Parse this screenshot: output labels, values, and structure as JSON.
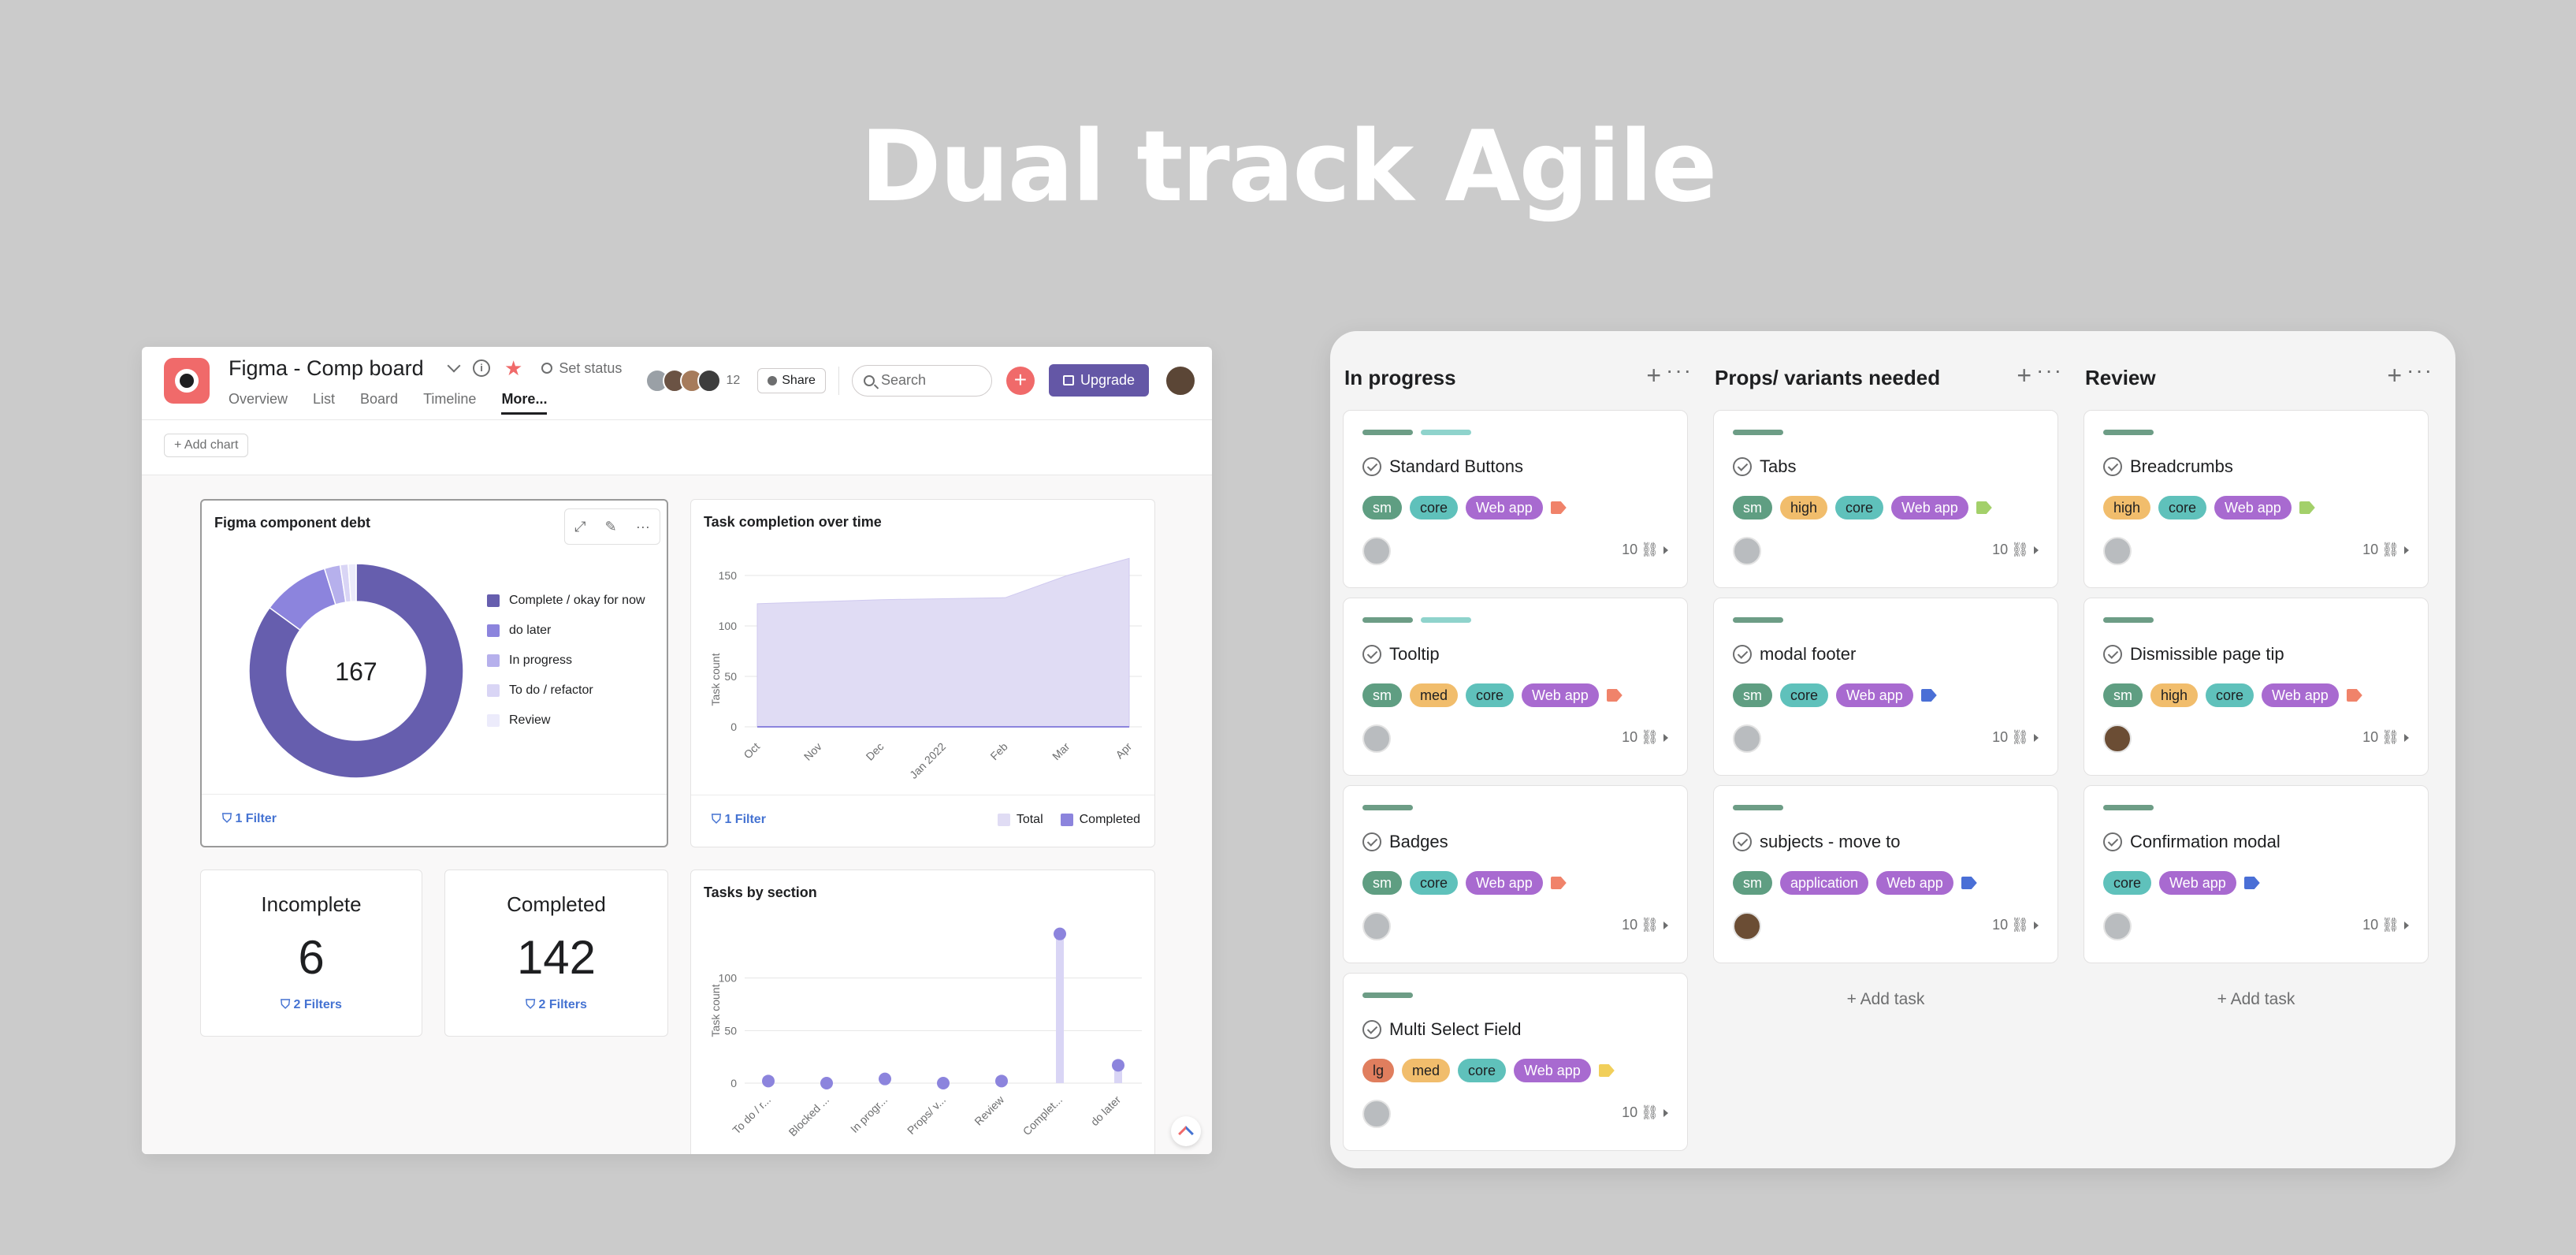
{
  "hero_title": "Dual track Agile",
  "dashboard": {
    "project_title": "Figma - Comp board",
    "set_status": "Set status",
    "tabs": [
      "Overview",
      "List",
      "Board",
      "Timeline",
      "More..."
    ],
    "active_tab": "More...",
    "member_count": "12",
    "share_label": "Share",
    "search_placeholder": "Search",
    "upgrade_label": "Upgrade",
    "add_chart_label": "+ Add chart",
    "donut_card": {
      "title": "Figma component debt",
      "center_value": "167",
      "filter": "1 Filter"
    },
    "line_card": {
      "title": "Task completion over time",
      "filter": "1 Filter",
      "legend_total": "Total",
      "legend_completed": "Completed"
    },
    "incomplete": {
      "label": "Incomplete",
      "value": "6",
      "filter": "2 Filters"
    },
    "completed": {
      "label": "Completed",
      "value": "142",
      "filter": "2 Filters"
    },
    "section_card": {
      "title": "Tasks by section"
    }
  },
  "chart_data": [
    {
      "type": "pie",
      "title": "Figma component debt",
      "categories": [
        "Complete / okay for now",
        "do later",
        "In progress",
        "To do / refactor",
        "Review"
      ],
      "values": [
        142,
        17,
        4,
        2,
        2
      ],
      "colors": [
        "#665eae",
        "#8c84dd",
        "#b6b0ec",
        "#d9d5f5",
        "#ecebfb"
      ],
      "center_total": 167,
      "legend": "right"
    },
    {
      "type": "area",
      "title": "Task completion over time",
      "ylabel": "Task count",
      "categories": [
        "Oct",
        "Nov",
        "Dec",
        "Jan 2022",
        "Feb",
        "Mar",
        "Apr"
      ],
      "series": [
        {
          "name": "Total",
          "values": [
            122,
            124,
            126,
            127,
            128,
            150,
            167
          ],
          "color": "#e0dcf4"
        },
        {
          "name": "Completed",
          "values": [
            0,
            0,
            0,
            0,
            0,
            0,
            0
          ],
          "color": "#8c84dd"
        }
      ],
      "ylim": [
        0,
        150
      ],
      "yticks": [
        0,
        50,
        100,
        150
      ],
      "grid": true,
      "legend": "bottom-right"
    },
    {
      "type": "bar",
      "title": "Tasks by section",
      "ylabel": "Task count",
      "categories": [
        "To do / r...",
        "Blocked ...",
        "In progr...",
        "Props/ v...",
        "Review",
        "Complet...",
        "do later"
      ],
      "values": [
        2,
        0,
        4,
        0,
        2,
        142,
        17
      ],
      "yticks": [
        0,
        50,
        100
      ],
      "ylim": [
        0,
        150
      ],
      "grid": true,
      "color": "#8c84dd"
    }
  ],
  "board": {
    "add_task_label": "+ Add task",
    "columns": [
      {
        "title": "In progress",
        "tasks": [
          {
            "name": "Standard Buttons",
            "bars": [
              "green",
              "teal"
            ],
            "tags": [
              [
                "sm",
                "sm"
              ],
              [
                "core",
                "core"
              ],
              [
                "Web app",
                "webapp"
              ]
            ],
            "tag_icon_color": "#f0836a",
            "meta": "10",
            "avatar": "grey"
          },
          {
            "name": "Tooltip",
            "bars": [
              "green",
              "teal"
            ],
            "tags": [
              [
                "sm",
                "sm"
              ],
              [
                "med",
                "med"
              ],
              [
                "core",
                "core"
              ],
              [
                "Web app",
                "webapp"
              ]
            ],
            "tag_icon_color": "#f0836a",
            "meta": "10",
            "avatar": "grey"
          },
          {
            "name": "Badges",
            "bars": [
              "green"
            ],
            "tags": [
              [
                "sm",
                "sm"
              ],
              [
                "core",
                "core"
              ],
              [
                "Web app",
                "webapp"
              ]
            ],
            "tag_icon_color": "#f0836a",
            "meta": "10",
            "avatar": "grey"
          },
          {
            "name": "Multi Select Field",
            "bars": [
              "green"
            ],
            "tags": [
              [
                "lg",
                "lg"
              ],
              [
                "med",
                "med"
              ],
              [
                "core",
                "core"
              ],
              [
                "Web app",
                "webapp"
              ]
            ],
            "tag_icon_color": "#f1cf5a",
            "meta": "10",
            "avatar": "grey"
          }
        ]
      },
      {
        "title": "Props/ variants needed",
        "tasks": [
          {
            "name": "Tabs",
            "bars": [
              "green"
            ],
            "tags": [
              [
                "sm",
                "sm"
              ],
              [
                "high",
                "high"
              ],
              [
                "core",
                "core"
              ],
              [
                "Web app",
                "webapp"
              ]
            ],
            "tag_icon_color": "#a3d06a",
            "meta": "10",
            "avatar": "grey"
          },
          {
            "name": "modal footer",
            "bars": [
              "green"
            ],
            "tags": [
              [
                "sm",
                "sm"
              ],
              [
                "core",
                "core"
              ],
              [
                "Web app",
                "webapp"
              ]
            ],
            "tag_icon_color": "#4a6fd6",
            "meta": "10",
            "avatar": "grey"
          },
          {
            "name": "subjects - move to",
            "bars": [
              "green"
            ],
            "tags": [
              [
                "sm",
                "sm"
              ],
              [
                "application",
                "application"
              ],
              [
                "Web app",
                "webapp"
              ]
            ],
            "tag_icon_color": "#4a6fd6",
            "meta": "10",
            "avatar": "dark"
          }
        ]
      },
      {
        "title": "Review",
        "tasks": [
          {
            "name": "Breadcrumbs",
            "bars": [
              "green"
            ],
            "tags": [
              [
                "high",
                "high"
              ],
              [
                "core",
                "core"
              ],
              [
                "Web app",
                "webapp"
              ]
            ],
            "tag_icon_color": "#a3d06a",
            "meta": "10",
            "avatar": "grey"
          },
          {
            "name": "Dismissible page tip",
            "bars": [
              "green"
            ],
            "tags": [
              [
                "sm",
                "sm"
              ],
              [
                "high",
                "high"
              ],
              [
                "core",
                "core"
              ],
              [
                "Web app",
                "webapp"
              ]
            ],
            "tag_icon_color": "#f0836a",
            "meta": "10",
            "avatar": "dark"
          },
          {
            "name": "Confirmation modal",
            "bars": [
              "green"
            ],
            "tags": [
              [
                "core",
                "core"
              ],
              [
                "Web app",
                "webapp"
              ]
            ],
            "tag_icon_color": "#4a6fd6",
            "meta": "10",
            "avatar": "grey"
          }
        ]
      }
    ]
  }
}
